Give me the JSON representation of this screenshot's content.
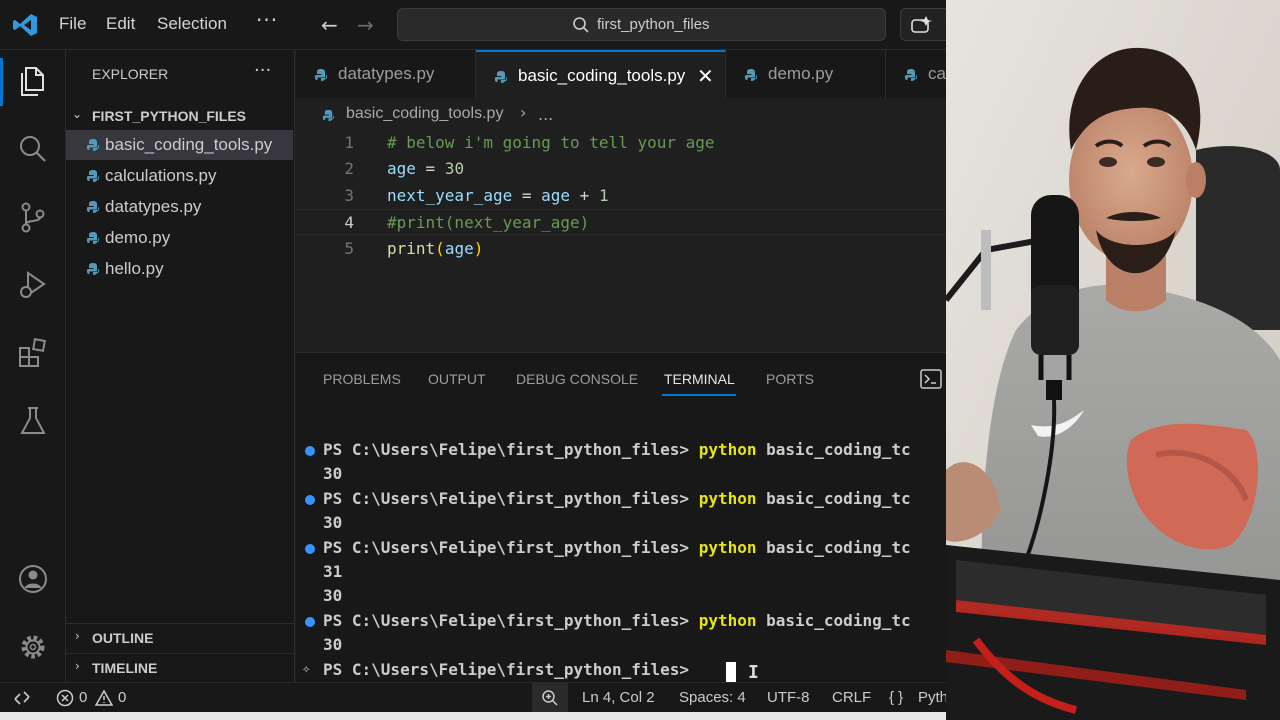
{
  "titlebar": {
    "menu": [
      "File",
      "Edit",
      "Selection"
    ],
    "more": "···",
    "search_text": "first_python_files"
  },
  "explorer": {
    "title": "EXPLORER",
    "more": "···",
    "folder_name": "FIRST_PYTHON_FILES",
    "files": [
      {
        "name": "basic_coding_tools.py",
        "selected": true
      },
      {
        "name": "calculations.py",
        "selected": false
      },
      {
        "name": "datatypes.py",
        "selected": false
      },
      {
        "name": "demo.py",
        "selected": false
      },
      {
        "name": "hello.py",
        "selected": false
      }
    ],
    "outline_label": "OUTLINE",
    "timeline_label": "TIMELINE"
  },
  "tabs": [
    {
      "label": "datatypes.py",
      "active": false
    },
    {
      "label": "basic_coding_tools.py",
      "active": true
    },
    {
      "label": "demo.py",
      "active": false
    },
    {
      "label": "ca",
      "active": false
    }
  ],
  "breadcrumb": {
    "file": "basic_coding_tools.py",
    "sep": "›",
    "more": "..."
  },
  "editor": {
    "current_line": 4,
    "lines": [
      {
        "num": "1",
        "text": "# below i'm going to tell your age"
      },
      {
        "num": "2",
        "text": "age = 30"
      },
      {
        "num": "3",
        "text": "next_year_age = age + 1"
      },
      {
        "num": "4",
        "text": "#print(next_year_age)"
      },
      {
        "num": "5",
        "text": "print(age)"
      }
    ]
  },
  "panel": {
    "tabs": [
      "PROBLEMS",
      "OUTPUT",
      "DEBUG CONSOLE",
      "TERMINAL",
      "PORTS"
    ],
    "active_tab": "TERMINAL"
  },
  "terminal": {
    "prompt": "PS C:\\Users\\Felipe\\first_python_files> ",
    "command": "python",
    "argument": " basic_coding_tc",
    "outputs": [
      "30",
      "30",
      "31",
      "30",
      "30"
    ]
  },
  "statusbar": {
    "errors": "0",
    "warnings": "0",
    "position": "Ln 4, Col 2",
    "spaces": "Spaces: 4",
    "encoding": "UTF-8",
    "eol": "CRLF",
    "braces": "{ }",
    "language": "Pyth"
  },
  "colors": {
    "accent": "#0078d4",
    "python_icon": "#519aba",
    "terminal_command": "#e5e510",
    "comment": "#6a9955",
    "variable": "#9cdcfe",
    "function": "#dcdcaa"
  },
  "icons": [
    "vscode-logo-icon",
    "explorer-icon",
    "search-icon",
    "source-control-icon",
    "run-debug-icon",
    "extensions-icon",
    "testing-icon",
    "account-icon",
    "settings-gear-icon",
    "python-file-icon",
    "close-icon",
    "new-terminal-icon",
    "remote-icon",
    "error-icon",
    "warning-icon",
    "zoom-icon"
  ]
}
